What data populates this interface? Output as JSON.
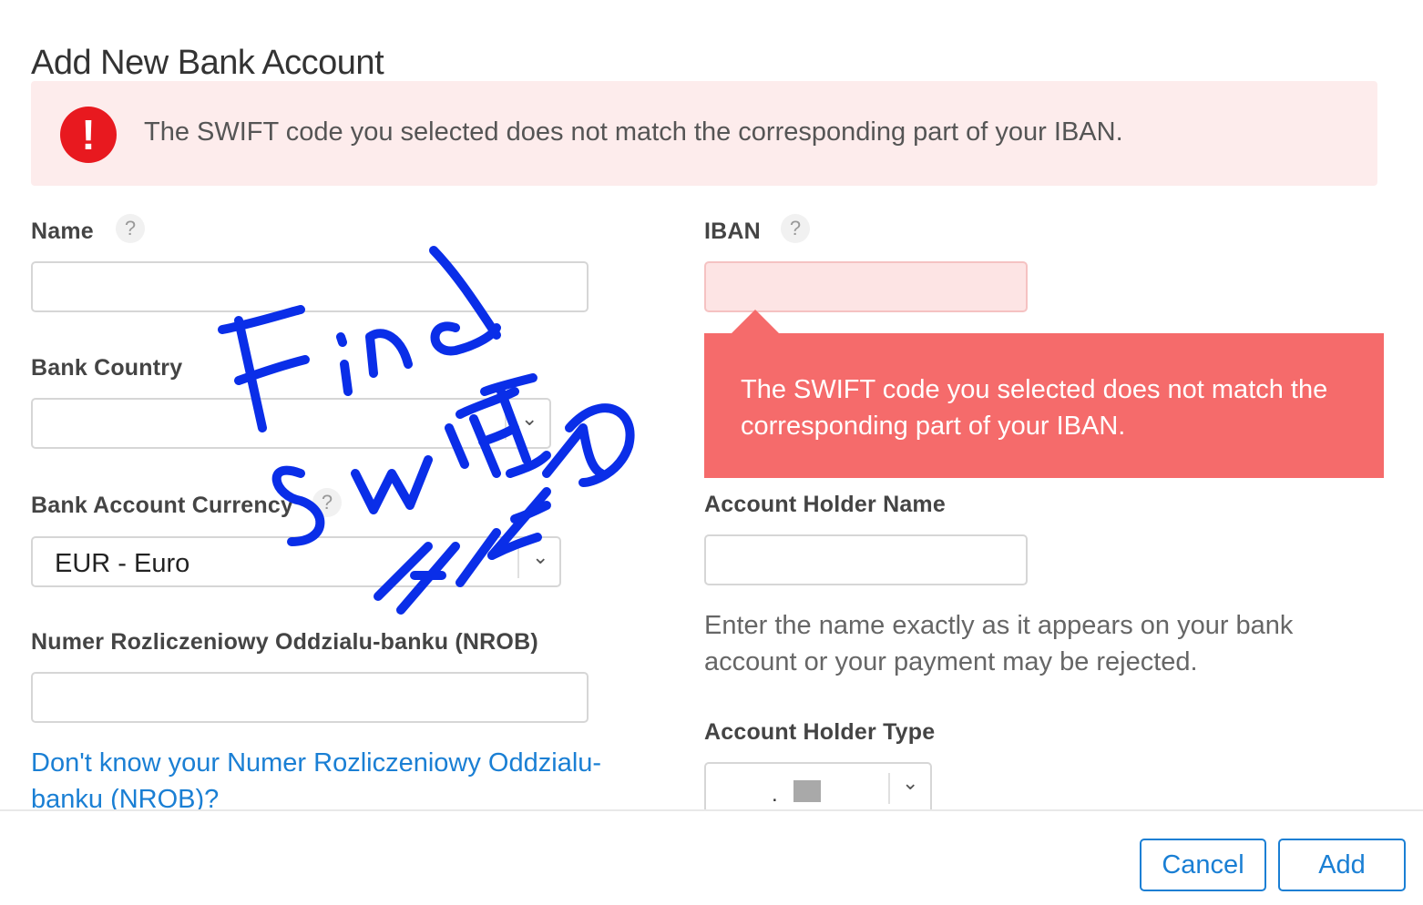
{
  "dialog": {
    "title": "Add New Bank Account",
    "alert_message": "The SWIFT code you selected does not match the corresponding part of your IBAN.",
    "alert_icon": "exclamation-icon"
  },
  "fields": {
    "name": {
      "label": "Name",
      "value": ""
    },
    "bank_country": {
      "label": "Bank Country",
      "value": ""
    },
    "currency": {
      "label": "Bank Account Currency",
      "value": "EUR - Euro"
    },
    "nrob": {
      "label": "Numer Rozliczeniowy Oddzialu-banku (NROB)",
      "value": ""
    },
    "iban": {
      "label": "IBAN",
      "value": ""
    },
    "account_holder_name": {
      "label": "Account Holder Name",
      "value": ""
    },
    "account_holder_type": {
      "label": "Account Holder Type",
      "value": ""
    }
  },
  "help_glyph": "?",
  "chevron_glyph": "⌄",
  "tooltip": {
    "message": "The SWIFT code you selected does not match the corresponding part of your IBAN."
  },
  "hint_text": "Enter the name exactly as it appears on your bank account or your payment may be rejected.",
  "nrob_link": "Don't know your Numer Rozliczeniowy Oddzialu-banku (NROB)?",
  "buttons": {
    "cancel": "Cancel",
    "add": "Add"
  },
  "annotation": {
    "lines": [
      "Find",
      "SWIFT",
      "FIELD"
    ],
    "color": "#0a2ee8"
  },
  "colors": {
    "accent": "#1a7fd4",
    "error": "#e8191f",
    "tooltip_bg": "#f56b6b",
    "alert_bg": "#fdecec"
  }
}
